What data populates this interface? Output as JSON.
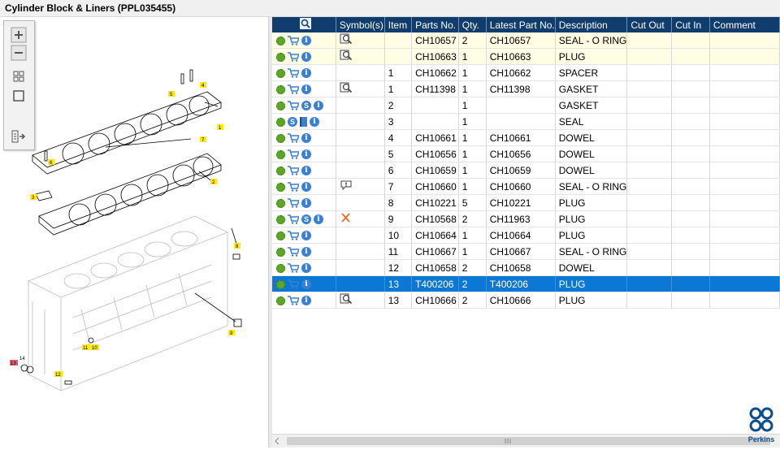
{
  "window": {
    "title": "Cylinder Block & Liners (PPL035455)"
  },
  "tools": {
    "zoom_in_icon": "plus-icon",
    "zoom_out_icon": "minus-icon",
    "fit_icon": "fit-grid-icon",
    "frame_icon": "frame-icon",
    "export_icon": "list-arrow-icon"
  },
  "diagram": {
    "callouts": [
      "1",
      "2",
      "3",
      "4",
      "5",
      "6",
      "7",
      "8",
      "9",
      "10",
      "11",
      "12",
      "13",
      "14"
    ]
  },
  "table": {
    "headers": [
      "",
      "Symbol(s)",
      "Item",
      "Parts No.",
      "Qty.",
      "Latest Part No.",
      "Description",
      "Cut Out",
      "Cut In",
      "Comment"
    ],
    "rows": [
      {
        "actions": [
          "gear",
          "cart",
          "info"
        ],
        "symbol": "magnifier",
        "item": "",
        "part": "CH10657",
        "qty": "2",
        "latest": "CH10657",
        "desc": "SEAL - O RING",
        "style": "yellow"
      },
      {
        "actions": [
          "gear",
          "cart",
          "info"
        ],
        "symbol": "magnifier",
        "item": "",
        "part": "CH10663",
        "qty": "1",
        "latest": "CH10663",
        "desc": "PLUG",
        "style": "yellow"
      },
      {
        "actions": [
          "gear",
          "cart",
          "info"
        ],
        "symbol": "",
        "item": "1",
        "part": "CH10662",
        "qty": "1",
        "latest": "CH10662",
        "desc": "SPACER",
        "style": ""
      },
      {
        "actions": [
          "gear",
          "cart",
          "info"
        ],
        "symbol": "magnifier",
        "item": "1",
        "part": "CH11398",
        "qty": "1",
        "latest": "CH11398",
        "desc": "GASKET",
        "style": ""
      },
      {
        "actions": [
          "gear",
          "cart",
          "s",
          "info"
        ],
        "symbol": "",
        "item": "2",
        "part": "",
        "qty": "1",
        "latest": "",
        "desc": "GASKET",
        "style": ""
      },
      {
        "actions": [
          "gear",
          "s",
          "book",
          "info"
        ],
        "symbol": "",
        "item": "3",
        "part": "",
        "qty": "1",
        "latest": "",
        "desc": "SEAL",
        "style": ""
      },
      {
        "actions": [
          "gear",
          "cart",
          "info"
        ],
        "symbol": "",
        "item": "4",
        "part": "CH10661",
        "qty": "1",
        "latest": "CH10661",
        "desc": "DOWEL",
        "style": ""
      },
      {
        "actions": [
          "gear",
          "cart",
          "info"
        ],
        "symbol": "",
        "item": "5",
        "part": "CH10656",
        "qty": "1",
        "latest": "CH10656",
        "desc": "DOWEL",
        "style": ""
      },
      {
        "actions": [
          "gear",
          "cart",
          "info"
        ],
        "symbol": "",
        "item": "6",
        "part": "CH10659",
        "qty": "1",
        "latest": "CH10659",
        "desc": "DOWEL",
        "style": ""
      },
      {
        "actions": [
          "gear",
          "cart",
          "info"
        ],
        "symbol": "speech",
        "item": "7",
        "part": "CH10660",
        "qty": "1",
        "latest": "CH10660",
        "desc": "SEAL - O RING",
        "style": ""
      },
      {
        "actions": [
          "gear",
          "cart",
          "info"
        ],
        "symbol": "",
        "item": "8",
        "part": "CH10221",
        "qty": "5",
        "latest": "CH10221",
        "desc": "PLUG",
        "style": ""
      },
      {
        "actions": [
          "gear",
          "cart",
          "s",
          "info"
        ],
        "symbol": "cross",
        "item": "9",
        "part": "CH10568",
        "qty": "2",
        "latest": "CH11963",
        "desc": "PLUG",
        "style": ""
      },
      {
        "actions": [
          "gear",
          "cart",
          "info"
        ],
        "symbol": "",
        "item": "10",
        "part": "CH10664",
        "qty": "1",
        "latest": "CH10664",
        "desc": "PLUG",
        "style": ""
      },
      {
        "actions": [
          "gear",
          "cart",
          "info"
        ],
        "symbol": "",
        "item": "11",
        "part": "CH10667",
        "qty": "1",
        "latest": "CH10667",
        "desc": "SEAL - O RING",
        "style": ""
      },
      {
        "actions": [
          "gear",
          "cart",
          "info"
        ],
        "symbol": "",
        "item": "12",
        "part": "CH10658",
        "qty": "2",
        "latest": "CH10658",
        "desc": "DOWEL",
        "style": ""
      },
      {
        "actions": [
          "gear",
          "cart",
          "info"
        ],
        "symbol": "",
        "item": "13",
        "part": "T400206",
        "qty": "2",
        "latest": "T400206",
        "desc": "PLUG",
        "style": "sel"
      },
      {
        "actions": [
          "gear",
          "cart",
          "info"
        ],
        "symbol": "magnifier",
        "item": "13",
        "part": "CH10666",
        "qty": "2",
        "latest": "CH10666",
        "desc": "PLUG",
        "style": ""
      }
    ]
  },
  "brand": {
    "name": "Perkins",
    "color": "#0d4d8c"
  },
  "colors": {
    "header": "#103c6e",
    "selected": "#0a78d4",
    "highlight": "#fffde4"
  }
}
